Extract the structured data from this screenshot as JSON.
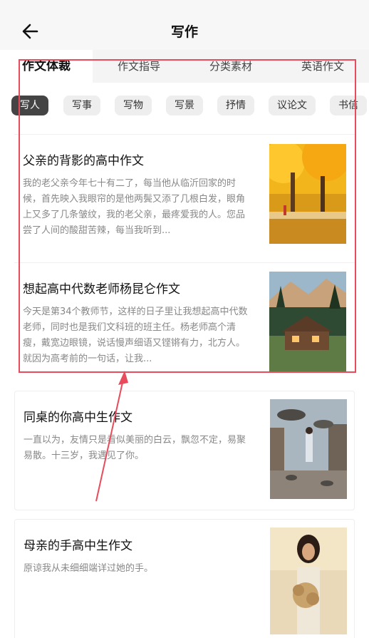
{
  "header": {
    "title": "写作",
    "back_icon": "arrow-left-icon"
  },
  "tabs": [
    {
      "label": "作文体裁",
      "active": true
    },
    {
      "label": "作文指导"
    },
    {
      "label": "分类素材"
    },
    {
      "label": "英语作文"
    }
  ],
  "chips": [
    {
      "label": "写人",
      "active": true
    },
    {
      "label": "写事"
    },
    {
      "label": "写物"
    },
    {
      "label": "写景"
    },
    {
      "label": "抒情"
    },
    {
      "label": "议论文"
    },
    {
      "label": "书信"
    }
  ],
  "articles": [
    {
      "title": "父亲的背影的高中作文",
      "excerpt": "我的老父亲今年七十有二了，每当他从临沂回家的时候，首先映入我眼帘的是他两鬓又添了几根白发，眼角上又多了几条皱纹，我的老父亲，最疼爱我的人。您品尝了人间的酸甜苦辣，每当我听到..."
    },
    {
      "title": "想起高中代数老师杨昆仑作文",
      "excerpt": "今天是第34个教师节，这样的日子里让我想起高中代数老师，同时也是我们文科班的班主任。杨老师高个清瘦，戴宽边眼镜，说话慢声细语又铿锵有力，北方人。就因为高考前的一句话，让我..."
    },
    {
      "title": "同桌的你高中生作文",
      "excerpt": "一直以为，友情只是看似美丽的白云，飘忽不定，易聚易散。十三岁，我遇见了你。"
    },
    {
      "title": "母亲的手高中生作文",
      "excerpt": "原谅我从未细细端详过她的手。"
    }
  ],
  "colors": {
    "accent_annotation": "#e84b5b",
    "chip_active": "#444444"
  }
}
